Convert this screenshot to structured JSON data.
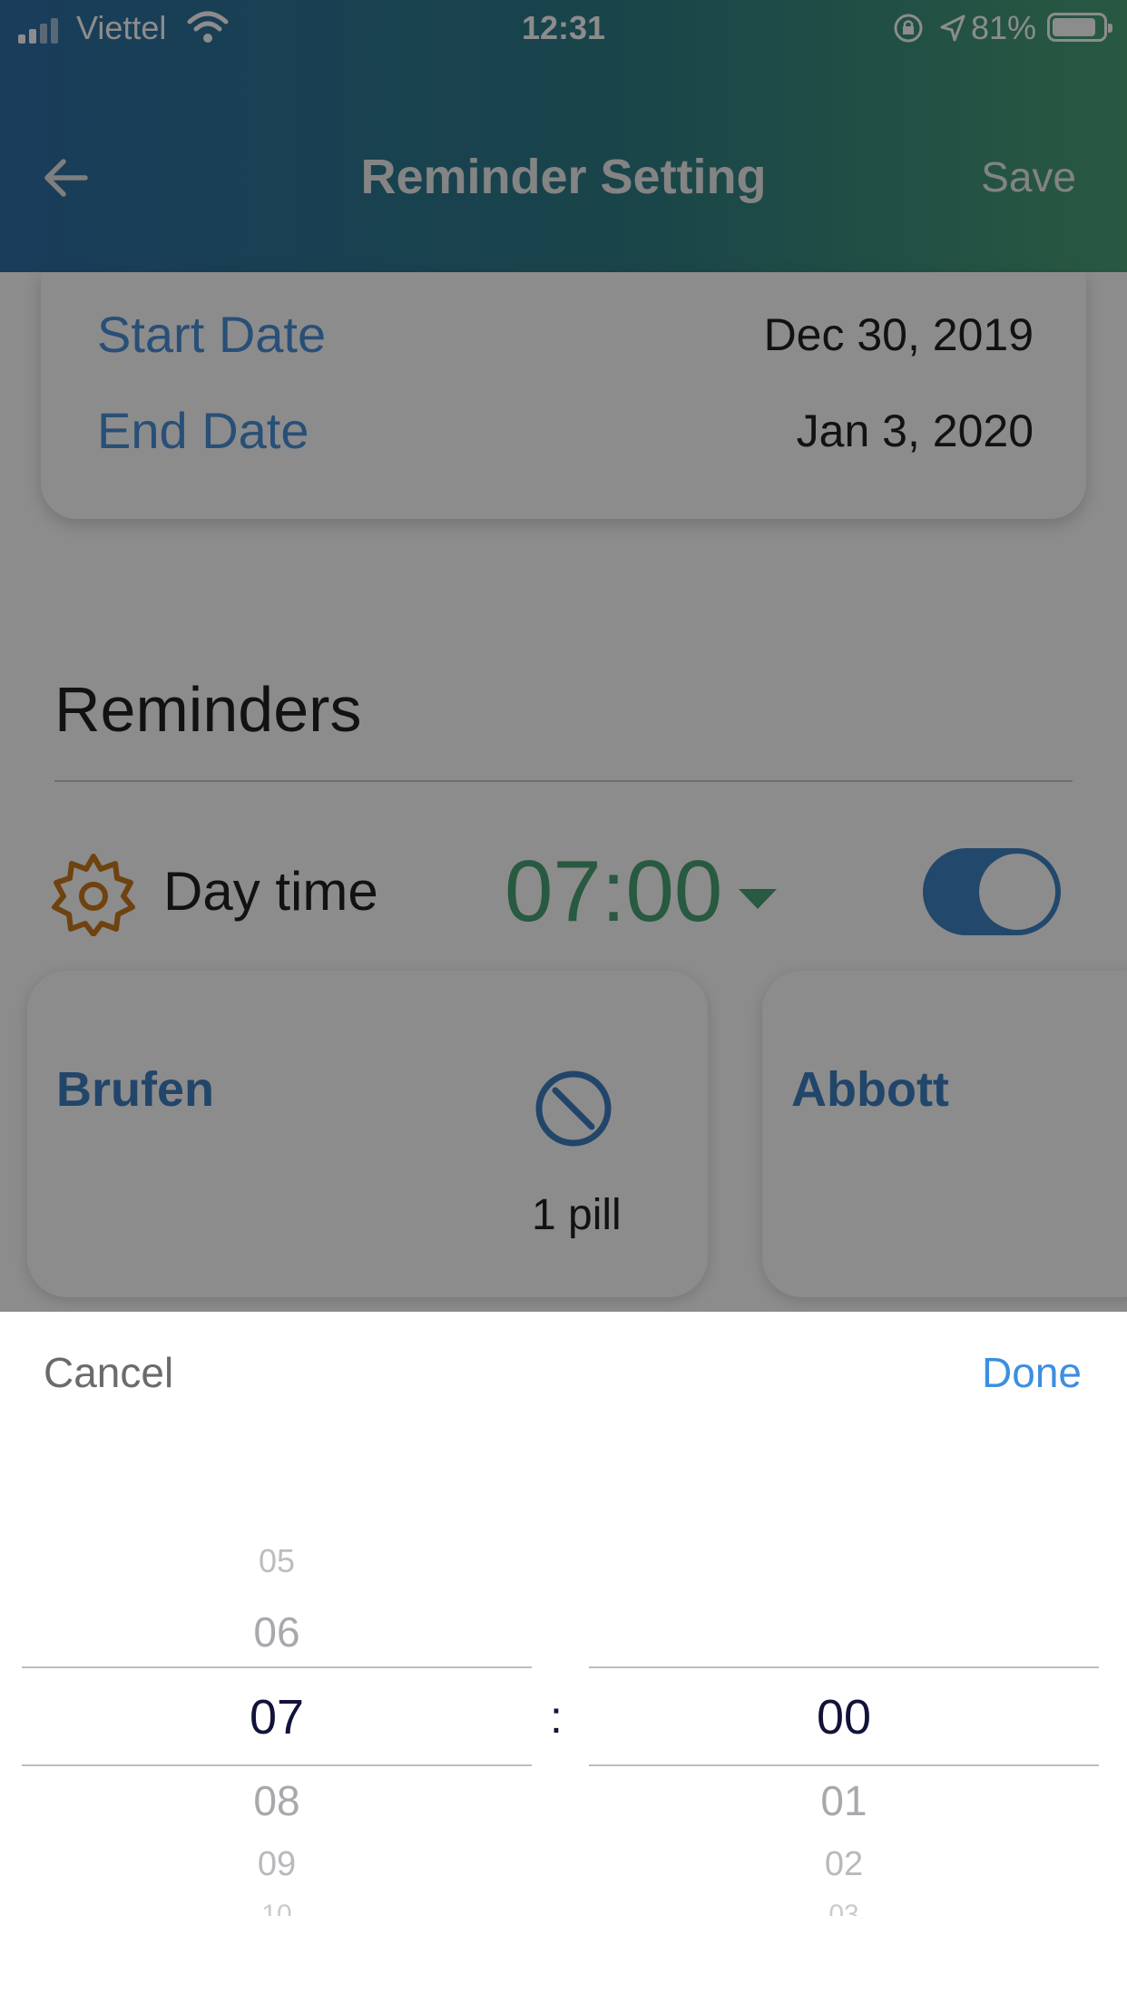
{
  "status_bar": {
    "carrier": "Viettel",
    "time": "12:31",
    "battery_percent": "81%",
    "battery_level": 0.81,
    "icons": [
      "signal-icon",
      "wifi-icon",
      "rotation-lock-icon",
      "location-icon",
      "battery-icon"
    ]
  },
  "header": {
    "title": "Reminder Setting",
    "save_label": "Save",
    "back_icon": "arrow-left-icon",
    "gradient": [
      "#2f6fa6",
      "#4aa277"
    ]
  },
  "dates": {
    "start_label": "Start Date",
    "start_value": "Dec 30, 2019",
    "end_label": "End Date",
    "end_value": "Jan 3, 2020"
  },
  "reminders": {
    "title": "Reminders",
    "day_time_label": "Day time",
    "time_value": "07:00",
    "enabled": true,
    "icon": "gear-icon"
  },
  "pills": [
    {
      "name": "Brufen",
      "quantity": "1 pill",
      "icon": "no-entry-icon"
    },
    {
      "name": "Abbott"
    }
  ],
  "picker": {
    "cancel_label": "Cancel",
    "done_label": "Done",
    "separator": ":",
    "hours": {
      "above": [
        "05",
        "06"
      ],
      "selected": "07",
      "below": [
        "08",
        "09",
        "10"
      ]
    },
    "minutes": {
      "above": [],
      "selected": "00",
      "below": [
        "01",
        "02",
        "03"
      ]
    }
  },
  "colors": {
    "accent_blue": "#3f7fc2",
    "accent_green": "#4aa277",
    "done_blue": "#3d8ee0",
    "gear_orange": "#c97a1e"
  }
}
